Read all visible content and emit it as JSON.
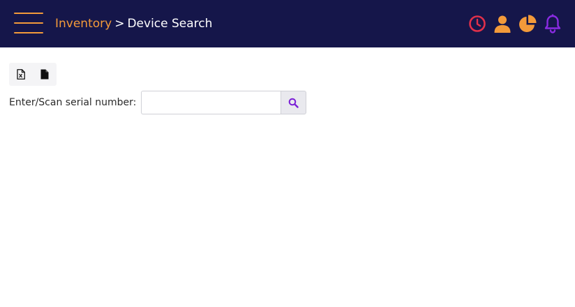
{
  "header": {
    "breadcrumb": {
      "parent": "Inventory",
      "separator": ">",
      "current": "Device Search"
    },
    "icons": {
      "menu": "hamburger-menu-icon",
      "history": "clock-icon",
      "user": "user-icon",
      "reports": "pie-chart-icon",
      "notifications": "bell-icon"
    },
    "colors": {
      "background": "#15164a",
      "accent": "#f39a3a",
      "history": "#e0304a",
      "notifications": "#8a2be2"
    }
  },
  "toolbar": {
    "icons": [
      "excel-file-icon",
      "file-icon"
    ]
  },
  "search": {
    "label": "Enter/Scan serial number:",
    "value": "",
    "placeholder": "",
    "button_icon": "search-icon",
    "button_icon_color": "#7a1fd6"
  }
}
